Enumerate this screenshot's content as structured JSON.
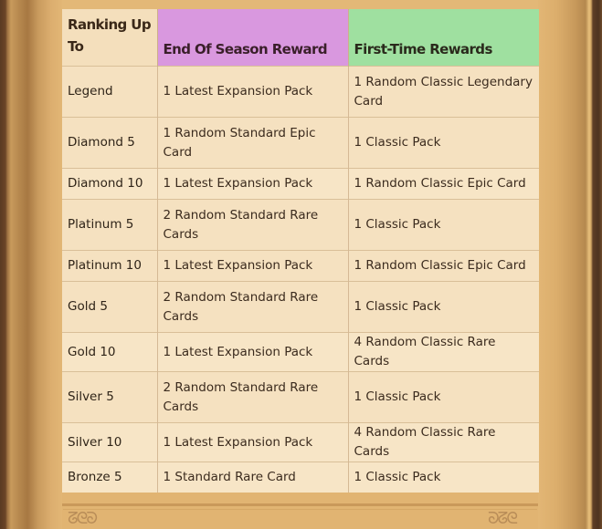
{
  "table": {
    "headers": {
      "rank": "Ranking Up To",
      "end_of_season": "End Of Season Reward",
      "first_time": "First-Time Rewards"
    },
    "header_colors": {
      "rank": "#f4dfbc",
      "end_of_season": "#d998df",
      "first_time": "#9fe0a0"
    },
    "rows": [
      {
        "rank": "Legend",
        "end_of_season": "1 Latest Expansion Pack",
        "first_time": "1 Random Classic Legendary Card"
      },
      {
        "rank": "Diamond 5",
        "end_of_season": "1 Random Standard Epic Card",
        "first_time": "1 Classic Pack"
      },
      {
        "rank": "Diamond 10",
        "end_of_season": "1 Latest Expansion Pack",
        "first_time": "1 Random Classic Epic Card"
      },
      {
        "rank": "Platinum 5",
        "end_of_season": "2 Random Standard Rare Cards",
        "first_time": "1 Classic Pack"
      },
      {
        "rank": "Platinum 10",
        "end_of_season": "1 Latest Expansion Pack",
        "first_time": "1 Random Classic Epic Card"
      },
      {
        "rank": "Gold 5",
        "end_of_season": "2 Random Standard Rare Cards",
        "first_time": "1 Classic Pack"
      },
      {
        "rank": "Gold 10",
        "end_of_season": "1 Latest Expansion Pack",
        "first_time": "4 Random Classic Rare Cards"
      },
      {
        "rank": "Silver 5",
        "end_of_season": "2 Random Standard Rare Cards",
        "first_time": "1 Classic Pack"
      },
      {
        "rank": "Silver 10",
        "end_of_season": "1 Latest Expansion Pack",
        "first_time": "4 Random Classic Rare Cards"
      },
      {
        "rank": "Bronze 5",
        "end_of_season": "1 Standard Rare Card",
        "first_time": "1 Classic Pack"
      }
    ]
  },
  "decor": {
    "flourish_left": "ᘔᘓᘐ",
    "flourish_right": "ᘐᘔᘓ"
  }
}
